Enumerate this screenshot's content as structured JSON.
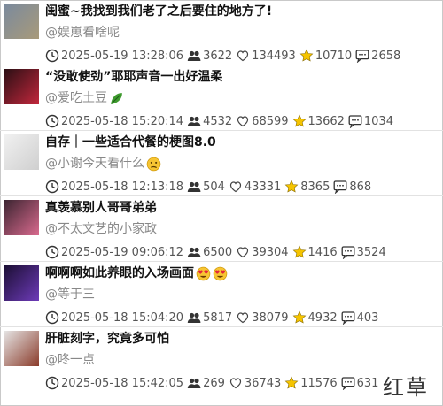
{
  "items": [
    {
      "title": "闺蜜~我找到我们老了之后要住的地方了!",
      "author": "@娱崽看啥呢",
      "date": "2025-05-19 13:28:06",
      "followers": "3622",
      "likes": "134493",
      "stars": "10710",
      "comments": "2658",
      "thumb_colors": [
        "#7a8a9e",
        "#a89a7a"
      ]
    },
    {
      "title": "“没敢使劲”耶耶声音一出好温柔",
      "author": "@爱吃土豆",
      "author_emoji": "leaf-icon",
      "date": "2025-05-18 15:20:14",
      "followers": "4532",
      "likes": "68599",
      "stars": "13662",
      "comments": "1034",
      "thumb_colors": [
        "#2a0f14",
        "#c2273c"
      ]
    },
    {
      "title": "自存｜一些适合代餐的梗图8.0",
      "author": "@小谢今天看什么",
      "author_emoji": "confused-face-icon",
      "date": "2025-05-18 12:13:18",
      "followers": "504",
      "likes": "43331",
      "stars": "8365",
      "comments": "868",
      "thumb_colors": [
        "#f1f1f1",
        "#cfcfcf"
      ]
    },
    {
      "title": "真羡慕别人哥哥弟弟",
      "author": "@不太文艺的小家政",
      "date": "2025-05-19 09:06:12",
      "followers": "6500",
      "likes": "39304",
      "stars": "1416",
      "comments": "3524",
      "thumb_colors": [
        "#3a2430",
        "#d96a8e"
      ]
    },
    {
      "title": "啊啊啊如此养眼的入场画面",
      "title_emoji": "heart-eyes-icon",
      "author": "@等于三",
      "date": "2025-05-18 15:04:20",
      "followers": "5817",
      "likes": "38079",
      "stars": "4932",
      "comments": "403",
      "thumb_colors": [
        "#1b0e33",
        "#6d3bb8"
      ]
    },
    {
      "title": "肝脏刻字，究竟多可怕",
      "author": "@咚一点",
      "date": "2025-05-18 15:42:05",
      "followers": "269",
      "likes": "36743",
      "stars": "11576",
      "comments": "631",
      "thumb_colors": [
        "#e6e6e6",
        "#8a3b2a"
      ]
    }
  ],
  "watermark": "红草",
  "colors": {
    "star": "#f5c400",
    "text": "#111111",
    "muted": "#888888"
  }
}
